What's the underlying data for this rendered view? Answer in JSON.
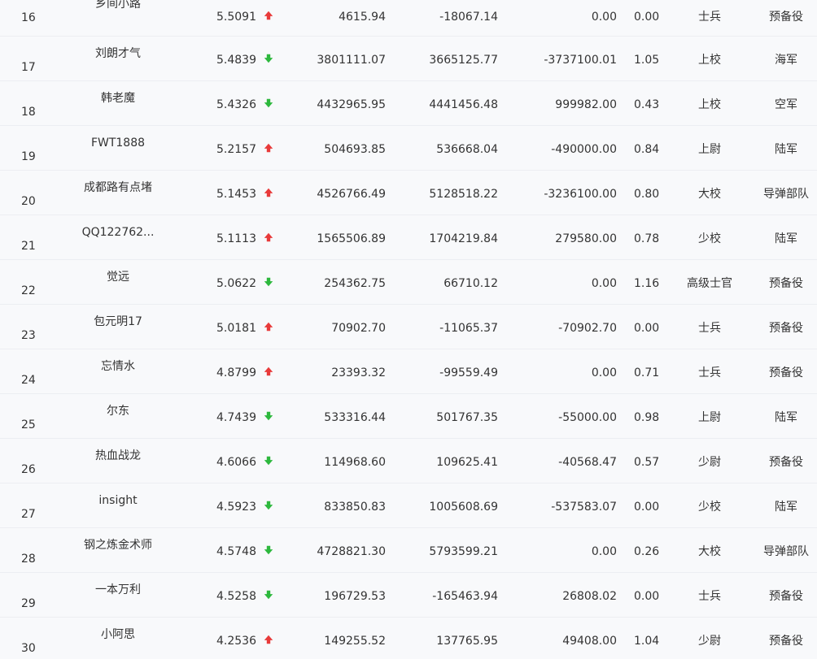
{
  "colors": {
    "up_arrow": "#e83a3a",
    "down_arrow": "#2db83d",
    "text": "#333333",
    "background": "#f8f9fb"
  },
  "rows": [
    {
      "rank": "16",
      "name": "乡间小路",
      "score": "5.5091",
      "trend": "up",
      "v1": "4615.94",
      "v2": "-18067.14",
      "v3": "0.00",
      "ratio": "0.00",
      "title": "士兵",
      "unit": "预备役"
    },
    {
      "rank": "17",
      "name": "刘朗才气",
      "score": "5.4839",
      "trend": "down",
      "v1": "3801111.07",
      "v2": "3665125.77",
      "v3": "-3737100.01",
      "ratio": "1.05",
      "title": "上校",
      "unit": "海军"
    },
    {
      "rank": "18",
      "name": "韩老魔",
      "score": "5.4326",
      "trend": "down",
      "v1": "4432965.95",
      "v2": "4441456.48",
      "v3": "999982.00",
      "ratio": "0.43",
      "title": "上校",
      "unit": "空军"
    },
    {
      "rank": "19",
      "name": "FWT1888",
      "score": "5.2157",
      "trend": "up",
      "v1": "504693.85",
      "v2": "536668.04",
      "v3": "-490000.00",
      "ratio": "0.84",
      "title": "上尉",
      "unit": "陆军"
    },
    {
      "rank": "20",
      "name": "成都路有点堵",
      "score": "5.1453",
      "trend": "up",
      "v1": "4526766.49",
      "v2": "5128518.22",
      "v3": "-3236100.00",
      "ratio": "0.80",
      "title": "大校",
      "unit": "导弹部队"
    },
    {
      "rank": "21",
      "name": "QQ122762...",
      "score": "5.1113",
      "trend": "up",
      "v1": "1565506.89",
      "v2": "1704219.84",
      "v3": "279580.00",
      "ratio": "0.78",
      "title": "少校",
      "unit": "陆军"
    },
    {
      "rank": "22",
      "name": "觉远",
      "score": "5.0622",
      "trend": "down",
      "v1": "254362.75",
      "v2": "66710.12",
      "v3": "0.00",
      "ratio": "1.16",
      "title": "高级士官",
      "unit": "预备役"
    },
    {
      "rank": "23",
      "name": "包元明17",
      "score": "5.0181",
      "trend": "up",
      "v1": "70902.70",
      "v2": "-11065.37",
      "v3": "-70902.70",
      "ratio": "0.00",
      "title": "士兵",
      "unit": "预备役"
    },
    {
      "rank": "24",
      "name": "忘情水",
      "score": "4.8799",
      "trend": "up",
      "v1": "23393.32",
      "v2": "-99559.49",
      "v3": "0.00",
      "ratio": "0.71",
      "title": "士兵",
      "unit": "预备役"
    },
    {
      "rank": "25",
      "name": "尔东",
      "score": "4.7439",
      "trend": "down",
      "v1": "533316.44",
      "v2": "501767.35",
      "v3": "-55000.00",
      "ratio": "0.98",
      "title": "上尉",
      "unit": "陆军"
    },
    {
      "rank": "26",
      "name": "热血战龙",
      "score": "4.6066",
      "trend": "down",
      "v1": "114968.60",
      "v2": "109625.41",
      "v3": "-40568.47",
      "ratio": "0.57",
      "title": "少尉",
      "unit": "预备役"
    },
    {
      "rank": "27",
      "name": "insight",
      "score": "4.5923",
      "trend": "down",
      "v1": "833850.83",
      "v2": "1005608.69",
      "v3": "-537583.07",
      "ratio": "0.00",
      "title": "少校",
      "unit": "陆军"
    },
    {
      "rank": "28",
      "name": "钢之炼金术师",
      "score": "4.5748",
      "trend": "down",
      "v1": "4728821.30",
      "v2": "5793599.21",
      "v3": "0.00",
      "ratio": "0.26",
      "title": "大校",
      "unit": "导弹部队"
    },
    {
      "rank": "29",
      "name": "一本万利",
      "score": "4.5258",
      "trend": "down",
      "v1": "196729.53",
      "v2": "-165463.94",
      "v3": "26808.02",
      "ratio": "0.00",
      "title": "士兵",
      "unit": "预备役"
    },
    {
      "rank": "30",
      "name": "小阿思",
      "score": "4.2536",
      "trend": "up",
      "v1": "149255.52",
      "v2": "137765.95",
      "v3": "49408.00",
      "ratio": "1.04",
      "title": "少尉",
      "unit": "预备役"
    }
  ]
}
